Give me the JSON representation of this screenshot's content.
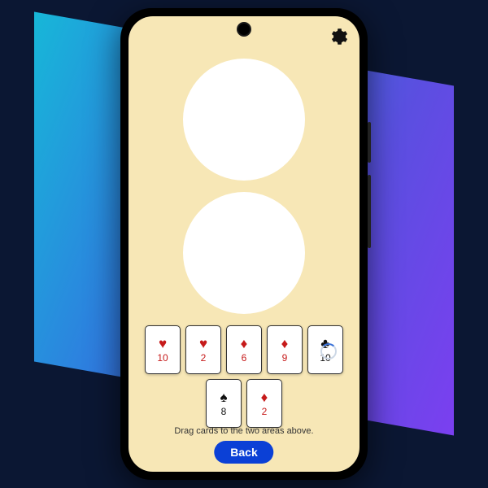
{
  "hint_text": "Drag cards to the two areas above.",
  "back_label": "Back",
  "suits": {
    "heart": "♥",
    "diamond": "♦",
    "spade": "♠",
    "club": "♣"
  },
  "cards_row1": [
    {
      "suit": "heart",
      "color": "red",
      "rank": "10"
    },
    {
      "suit": "heart",
      "color": "red",
      "rank": "2"
    },
    {
      "suit": "diamond",
      "color": "red",
      "rank": "6"
    },
    {
      "suit": "diamond",
      "color": "red",
      "rank": "9"
    },
    {
      "suit": "club",
      "color": "black",
      "rank": "10"
    }
  ],
  "cards_row2": [
    {
      "suit": "spade",
      "color": "black",
      "rank": "8"
    },
    {
      "suit": "diamond",
      "color": "red",
      "rank": "2"
    }
  ],
  "colors": {
    "screen_bg": "#f7e7b6",
    "button_bg": "#0b40d6"
  }
}
